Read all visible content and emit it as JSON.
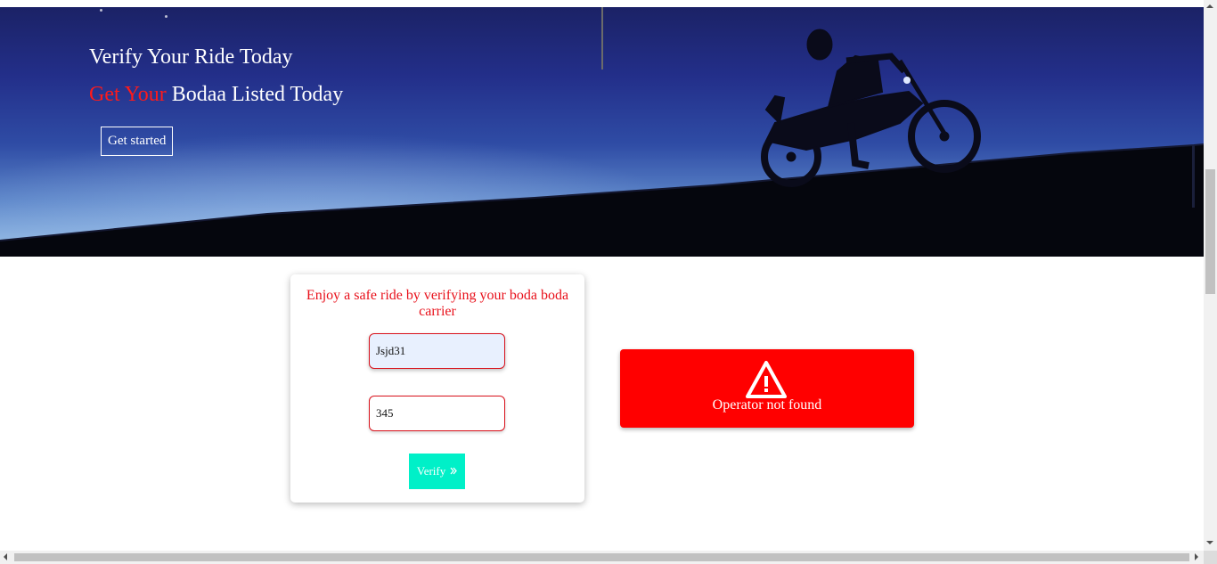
{
  "hero": {
    "title": "Verify Your Ride Today",
    "subtitle_accent": "Get Your",
    "subtitle_rest": "Bodaa Listed Today",
    "cta_label": "Get started",
    "accent_color": "#ff1a1a"
  },
  "verify_card": {
    "heading": "Enjoy a safe ride by verifying your boda boda carrier",
    "field_1_value": "Jsjd31",
    "field_2_value": "345",
    "verify_label": "Verify",
    "verify_icon": "double-chevron-right-icon",
    "button_color": "#00f0c8"
  },
  "alert": {
    "icon": "warning-icon",
    "message": "Operator not found",
    "color": "#ff0000"
  }
}
